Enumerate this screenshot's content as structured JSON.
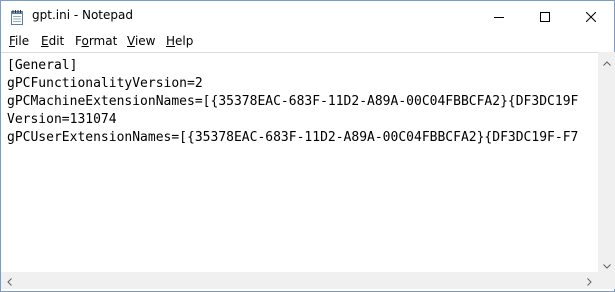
{
  "window": {
    "title": "gpt.ini - Notepad"
  },
  "menu": {
    "file": {
      "accel": "F",
      "rest": "ile"
    },
    "edit": {
      "accel": "E",
      "rest": "dit"
    },
    "format": {
      "pre": "F",
      "accel": "o",
      "rest": "rmat"
    },
    "view": {
      "accel": "V",
      "rest": "iew"
    },
    "help": {
      "accel": "H",
      "rest": "elp"
    }
  },
  "content": {
    "lines": [
      "[General]",
      "gPCFunctionalityVersion=2",
      "gPCMachineExtensionNames=[{35378EAC-683F-11D2-A89A-00C04FBBCFA2}{DF3DC19F",
      "Version=131074",
      "gPCUserExtensionNames=[{35378EAC-683F-11D2-A89A-00C04FBBCFA2}{DF3DC19F-F7"
    ]
  },
  "icons": {
    "app": "notepad-icon",
    "minimize": "minimize-icon",
    "maximize": "maximize-icon",
    "close": "close-icon",
    "scroll_up": "arrow-up-icon",
    "scroll_down": "arrow-down-icon",
    "scroll_left": "arrow-left-icon",
    "scroll_right": "arrow-right-icon"
  },
  "colors": {
    "window_border": "#7a9cc6",
    "scrollbar_bg": "#f0f0f0",
    "arrow": "#606060"
  }
}
